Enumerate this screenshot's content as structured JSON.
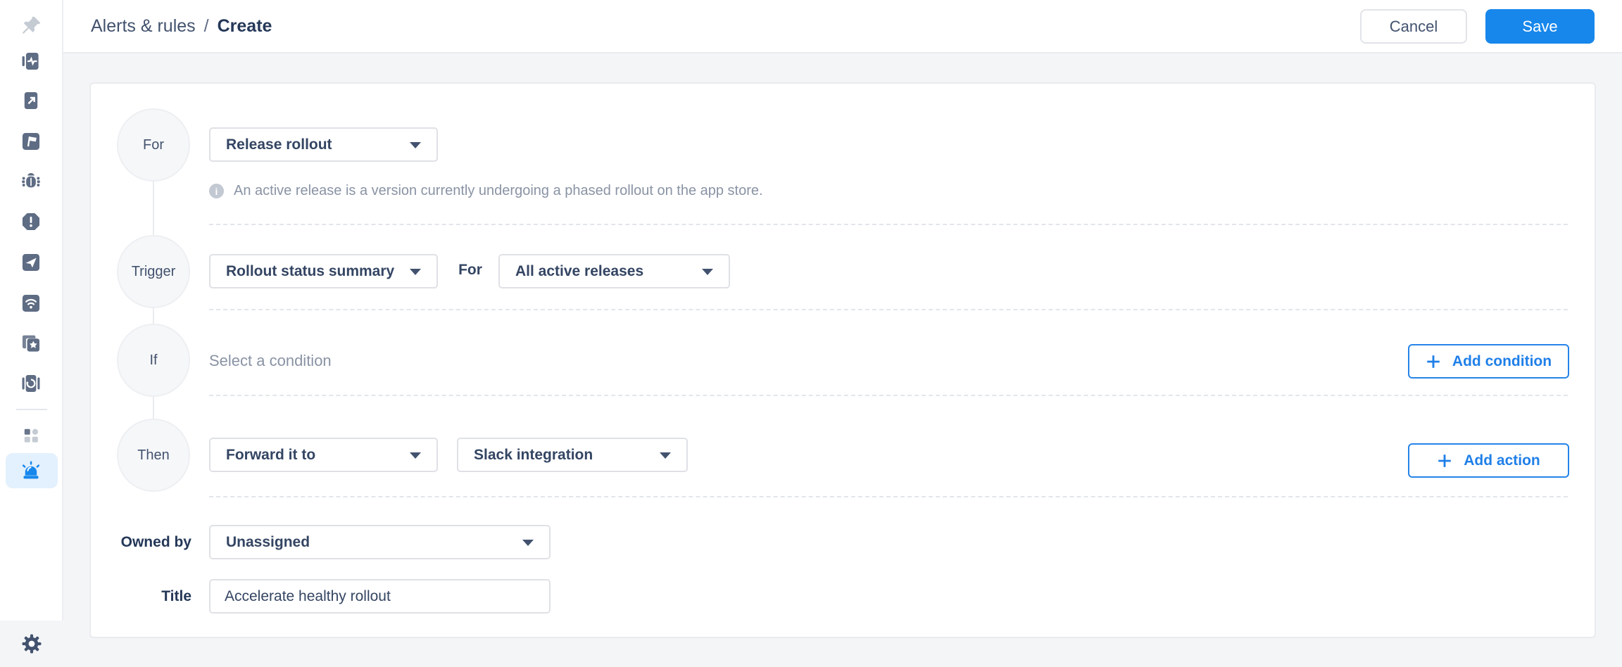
{
  "colors": {
    "accent_blue": "#1787ec",
    "sidebar_icon_slate": "#5e6c84",
    "sidebar_icon_muted": "#c5cbd3",
    "active_item_bg": "#e3f0fd",
    "page_bg": "#f4f5f7",
    "dark_text": "#253858",
    "body_text": "#344563",
    "muted_text": "#8993a4"
  },
  "sidebar": {
    "items": [
      {
        "icon": "pin-icon"
      },
      {
        "icon": "app-performance-icon"
      },
      {
        "icon": "app-launch-icon"
      },
      {
        "icon": "feature-flags-icon"
      },
      {
        "icon": "bug-reports-icon"
      },
      {
        "icon": "crashes-icon"
      },
      {
        "icon": "surveys-icon"
      },
      {
        "icon": "network-icon"
      },
      {
        "icon": "app-ratings-icon"
      },
      {
        "icon": "releases-icon"
      },
      {
        "icon": "apps-grid-icon"
      },
      {
        "icon": "alerts-icon",
        "active": true
      },
      {
        "icon": "settings-gear-icon"
      }
    ]
  },
  "header": {
    "breadcrumb_parent": "Alerts & rules",
    "breadcrumb_separator": "/",
    "breadcrumb_current": "Create",
    "cancel_label": "Cancel",
    "save_label": "Save"
  },
  "form": {
    "for_row": {
      "badge": "For",
      "select_value": "Release rollout",
      "helper_text": "An active release is a version currently undergoing a phased rollout on the app store."
    },
    "trigger_row": {
      "badge": "Trigger",
      "select_value": "Rollout status summary",
      "connector_label": "For",
      "scope_value": "All active releases"
    },
    "if_row": {
      "badge": "If",
      "placeholder_text": "Select a condition",
      "add_button_label": "Add condition"
    },
    "then_row": {
      "badge": "Then",
      "select_value": "Forward it to",
      "target_value": "Slack integration",
      "add_button_label": "Add action"
    },
    "owned_by_row": {
      "label": "Owned by",
      "value": "Unassigned"
    },
    "title_row": {
      "label": "Title",
      "value": "Accelerate healthy rollout"
    }
  }
}
